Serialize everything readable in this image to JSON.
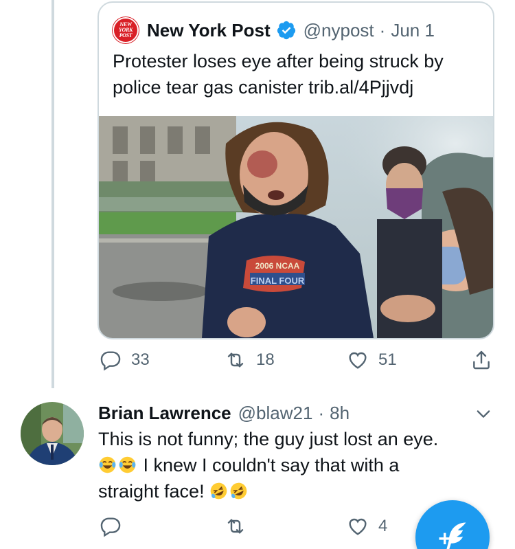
{
  "quoted_tweet": {
    "logo_text": "NEW YORK POST",
    "name": "New York Post",
    "handle": "@nypost",
    "separator": "·",
    "date": "Jun 1",
    "text": "Protester loses eye after being struck by police tear gas canister trib.al/4Pjjvdj",
    "photo_shirt_text_1": "2006 NCAA",
    "photo_shirt_text_2": "FINAL FOUR"
  },
  "tweet_actions": {
    "replies": "33",
    "retweets": "18",
    "likes": "51"
  },
  "reply": {
    "name": "Brian Lawrence",
    "handle": "@blaw21",
    "separator": "·",
    "time": "8h",
    "text_line_1": "This is not funny; the guy just lost an eye.",
    "text_line_2": "I knew I couldn't say that with a",
    "text_line_3": "straight face!",
    "likes": "4"
  },
  "colors": {
    "accent": "#1d9bf0",
    "muted": "#536471",
    "text": "#0f1419",
    "nypost_red": "#d91f26"
  },
  "icons": [
    "verified-icon",
    "reply-icon",
    "retweet-icon",
    "like-icon",
    "share-icon",
    "chevron-down-icon",
    "compose-icon"
  ]
}
